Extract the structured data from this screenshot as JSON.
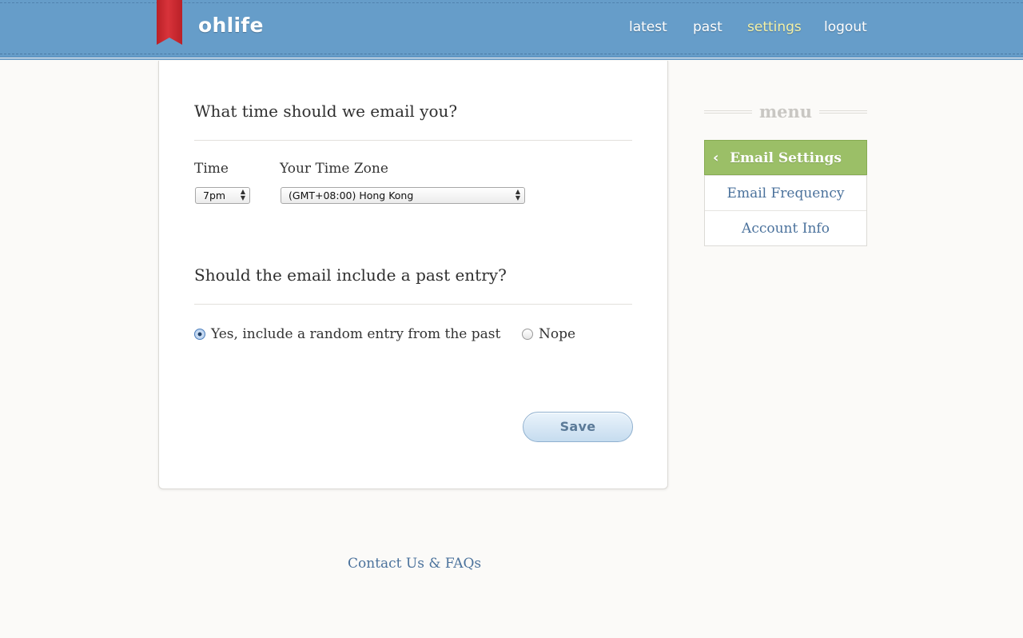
{
  "brand": {
    "name": "ohlife"
  },
  "nav": {
    "items": [
      {
        "label": "latest"
      },
      {
        "label": "past"
      },
      {
        "label": "settings",
        "active": true
      },
      {
        "label": "logout"
      }
    ]
  },
  "email_time": {
    "title": "What time should we email you?",
    "time_label": "Time",
    "time_value": "7pm",
    "timezone_label": "Your Time Zone",
    "timezone_value": "(GMT+08:00) Hong Kong"
  },
  "past_entry": {
    "title": "Should the email include a past entry?",
    "options": [
      {
        "label": "Yes, include a random entry from the past",
        "checked": true
      },
      {
        "label": "Nope",
        "checked": false
      }
    ]
  },
  "save_label": "Save",
  "menu": {
    "heading": "menu",
    "items": [
      {
        "label": "Email Settings",
        "active": true
      },
      {
        "label": "Email Frequency"
      },
      {
        "label": "Account Info"
      }
    ]
  },
  "footer": {
    "contact_label": "Contact Us & FAQs"
  },
  "colors": {
    "header_blue": "#669dc9",
    "ribbon_red": "#c8282f",
    "active_nav": "#f4f1a6",
    "menu_active_green": "#9bbf67",
    "link_blue": "#4b729c"
  }
}
